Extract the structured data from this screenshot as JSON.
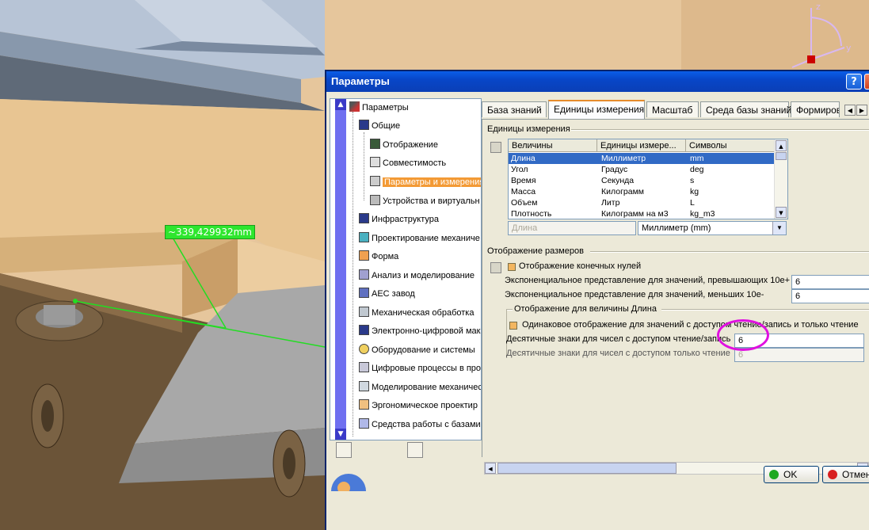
{
  "viewport": {
    "measurement_label": "~339,429932mm",
    "compass": {
      "axis_z": "z",
      "axis_y": "y"
    }
  },
  "dialog": {
    "title": "Параметры",
    "help_button": "?",
    "close_button": "×",
    "tree": {
      "items": [
        {
          "label": "Параметры"
        },
        {
          "label": "Общие"
        },
        {
          "label": "Отображение"
        },
        {
          "label": "Совместимость"
        },
        {
          "label": "Параметры и измерения"
        },
        {
          "label": "Устройства и виртуальн"
        },
        {
          "label": "Инфраструктура"
        },
        {
          "label": "Проектирование механиче"
        },
        {
          "label": "Форма"
        },
        {
          "label": "Анализ и моделирование"
        },
        {
          "label": "АЕС завод"
        },
        {
          "label": "Механическая обработка"
        },
        {
          "label": "Электронно-цифровой мак"
        },
        {
          "label": "Оборудование и системы"
        },
        {
          "label": "Цифровые процессы в про"
        },
        {
          "label": "Моделирование механичес"
        },
        {
          "label": "Эргономическое проектир"
        },
        {
          "label": "Средства работы с базами"
        }
      ],
      "selected": "Параметры и измерения"
    },
    "tabs": [
      {
        "label": "База знаний"
      },
      {
        "label": "Единицы измерения"
      },
      {
        "label": "Масштаб"
      },
      {
        "label": "Среда базы знаний"
      },
      {
        "label": "Формирова"
      }
    ],
    "active_tab": "Единицы измерения",
    "units_section": {
      "title": "Единицы измерения",
      "columns": [
        "Величины",
        "Единицы измере...",
        "Символы"
      ],
      "rows": [
        [
          "Длина",
          "Миллиметр",
          "mm"
        ],
        [
          "Угол",
          "Градус",
          "deg"
        ],
        [
          "Время",
          "Секунда",
          "s"
        ],
        [
          "Масса",
          "Килограмм",
          "kg"
        ],
        [
          "Объем",
          "Литр",
          "L"
        ],
        [
          "Плотность",
          "Килограмм на м3",
          "kg_m3"
        ]
      ],
      "selected_row": 0,
      "quantity_field": "Длина",
      "unit_combo": "Миллиметр (mm)"
    },
    "dimension_section": {
      "title": "Отображение размеров",
      "trailing_zeros_label": "Отображение конечных нулей",
      "exp_above_label": "Экспоненциальное представление для значений, превышающих 10е+",
      "exp_above_value": "6",
      "exp_below_label": "Экспоненциальное представление для значений, меньших 10е-",
      "exp_below_value": "6",
      "length_group_title": "Отображение для величины Длина",
      "same_display_label": "Одинаковое отображение для значений с доступом чтение/запись и только чтение",
      "rw_decimals_label": "Десятичные знаки для чисел с доступом чтение/запись",
      "rw_decimals_value": "6",
      "ro_decimals_label": "Десятичные знаки для чисел с доступом только чтение",
      "ro_decimals_value": "6"
    },
    "ok_button": "OK",
    "cancel_button": "Отмена",
    "colors": {
      "accent": "#e68b2c",
      "selection": "#316ac5",
      "titlebar": "#0846c8",
      "highlight": "#e010e0"
    }
  }
}
